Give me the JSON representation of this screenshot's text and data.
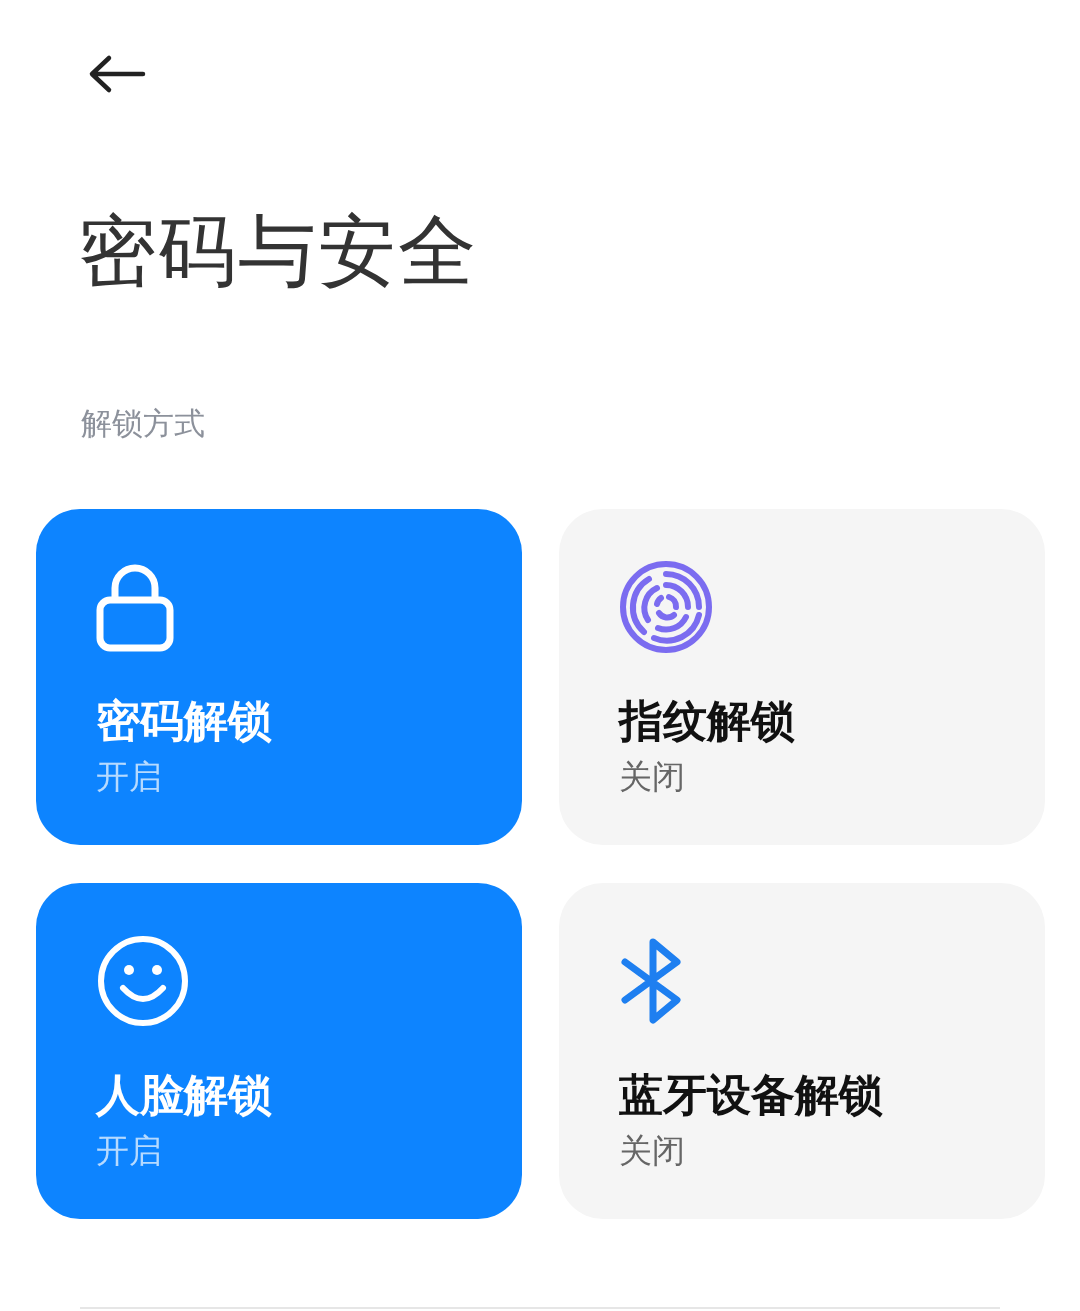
{
  "title": "密码与安全",
  "section": {
    "label": "解锁方式",
    "methods": [
      {
        "kind": "password",
        "label": "密码解锁",
        "status": "开启",
        "on": true
      },
      {
        "kind": "fingerprint",
        "label": "指纹解锁",
        "status": "关闭",
        "on": false
      },
      {
        "kind": "face",
        "label": "人脸解锁",
        "status": "开启",
        "on": true
      },
      {
        "kind": "bluetooth",
        "label": "蓝牙设备解锁",
        "status": "关闭",
        "on": false
      }
    ]
  }
}
